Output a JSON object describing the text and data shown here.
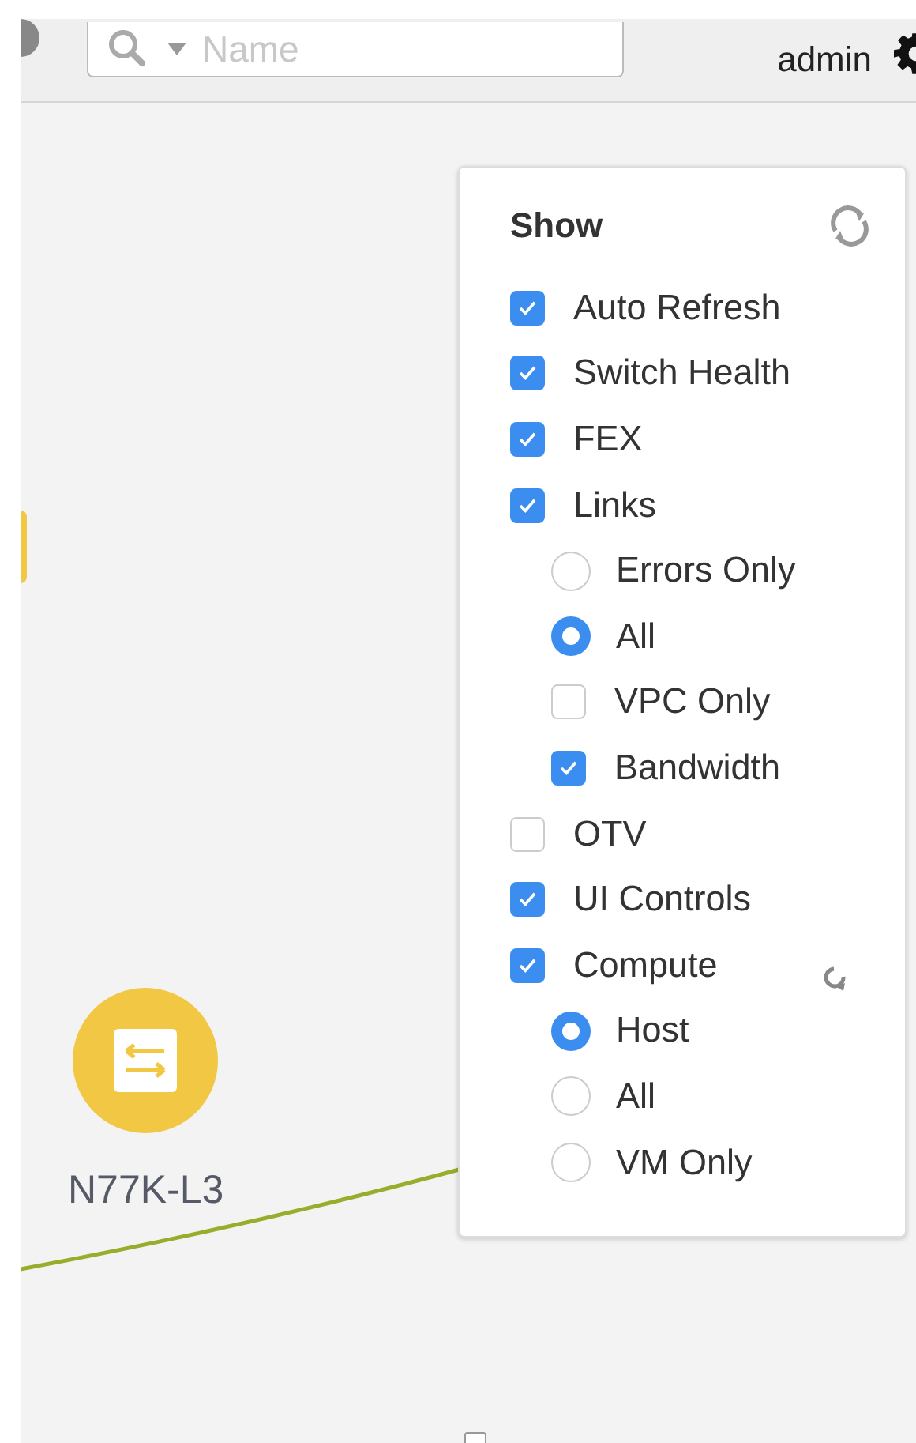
{
  "header": {
    "search": {
      "placeholder": "Name"
    },
    "user": "admin"
  },
  "canvas": {
    "nodes": [
      {
        "label": "N77K-L3"
      }
    ]
  },
  "show_panel": {
    "title": "Show",
    "options": [
      {
        "kind": "checkbox",
        "label": "Auto Refresh",
        "checked": true
      },
      {
        "kind": "checkbox",
        "label": "Switch Health",
        "checked": true
      },
      {
        "kind": "checkbox",
        "label": "FEX",
        "checked": true
      },
      {
        "kind": "checkbox",
        "label": "Links",
        "checked": true,
        "children": [
          {
            "kind": "radio",
            "label": "Errors Only",
            "selected": false
          },
          {
            "kind": "radio",
            "label": "All",
            "selected": true
          },
          {
            "kind": "checkbox",
            "label": "VPC Only",
            "checked": false
          },
          {
            "kind": "checkbox",
            "label": "Bandwidth",
            "checked": true
          }
        ]
      },
      {
        "kind": "checkbox",
        "label": "OTV",
        "checked": false
      },
      {
        "kind": "checkbox",
        "label": "UI Controls",
        "checked": true
      },
      {
        "kind": "checkbox",
        "label": "Compute",
        "checked": true,
        "reset": true,
        "children": [
          {
            "kind": "radio",
            "label": "Host",
            "selected": true
          },
          {
            "kind": "radio",
            "label": "All",
            "selected": false
          },
          {
            "kind": "radio",
            "label": "VM Only",
            "selected": false
          }
        ]
      }
    ]
  }
}
